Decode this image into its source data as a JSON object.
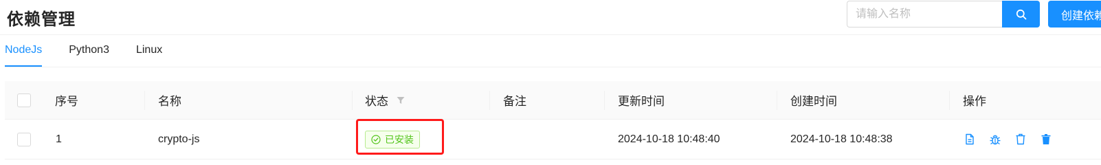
{
  "header": {
    "title": "依赖管理",
    "search_placeholder": "请输入名称",
    "create_label": "创建依赖"
  },
  "tabs": [
    {
      "label": "NodeJs",
      "active": true
    },
    {
      "label": "Python3",
      "active": false
    },
    {
      "label": "Linux",
      "active": false
    }
  ],
  "table": {
    "columns": [
      "序号",
      "名称",
      "状态",
      "备注",
      "更新时间",
      "创建时间",
      "操作"
    ],
    "rows": [
      {
        "index": "1",
        "name": "crypto-js",
        "status": "已安装",
        "remark": "",
        "updated_at": "2024-10-18 10:48:40",
        "created_at": "2024-10-18 10:48:38",
        "actions": [
          "log-icon",
          "debug-icon",
          "uninstall-icon",
          "delete-icon"
        ]
      }
    ]
  },
  "colors": {
    "accent": "#1890ff",
    "status_green": "#52c41a",
    "highlight_red": "#ff1a1a"
  }
}
